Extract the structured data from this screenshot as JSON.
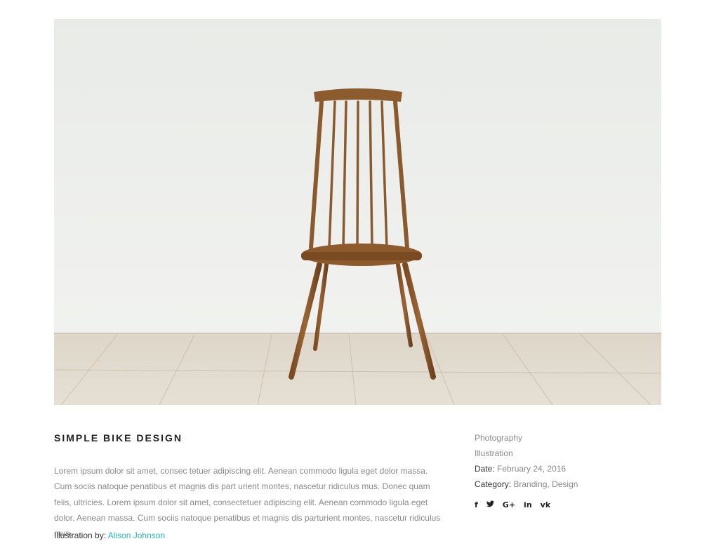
{
  "project": {
    "title": "SIMPLE BIKE DESIGN",
    "description": "Lorem ipsum dolor sit amet, consec tetuer adipiscing elit. Aenean commodo ligula eget dolor massa. Cum sociis natoque penatibus et magnis dis part urient montes, nascetur ridiculus mus. Donec quam felis, ultricies. Lorem ipsum dolor sit amet, consectetuer adipiscing elit. Aenean commodo ligula eget dolor. Aenean massa. Cum sociis natoque penatibus et magnis dis parturient montes, nascetur ridiculus mus.",
    "credit_label": "Illustration by:",
    "credit_name": "Alison Johnson"
  },
  "meta": {
    "tags": [
      "Photography",
      "Illustration"
    ],
    "date_label": "Date:",
    "date_value": "February 24, 2016",
    "category_label": "Category:",
    "category_value": "Branding, Design"
  },
  "social": [
    {
      "name": "facebook-icon",
      "glyph": "f"
    },
    {
      "name": "twitter-icon",
      "glyph": "🐦"
    },
    {
      "name": "google-plus-icon",
      "glyph": "G+"
    },
    {
      "name": "linkedin-icon",
      "glyph": "in"
    },
    {
      "name": "vk-icon",
      "glyph": "vk"
    }
  ],
  "colors": {
    "accent": "#2ab7b4",
    "text": "#8a8a8a",
    "heading": "#222222"
  }
}
